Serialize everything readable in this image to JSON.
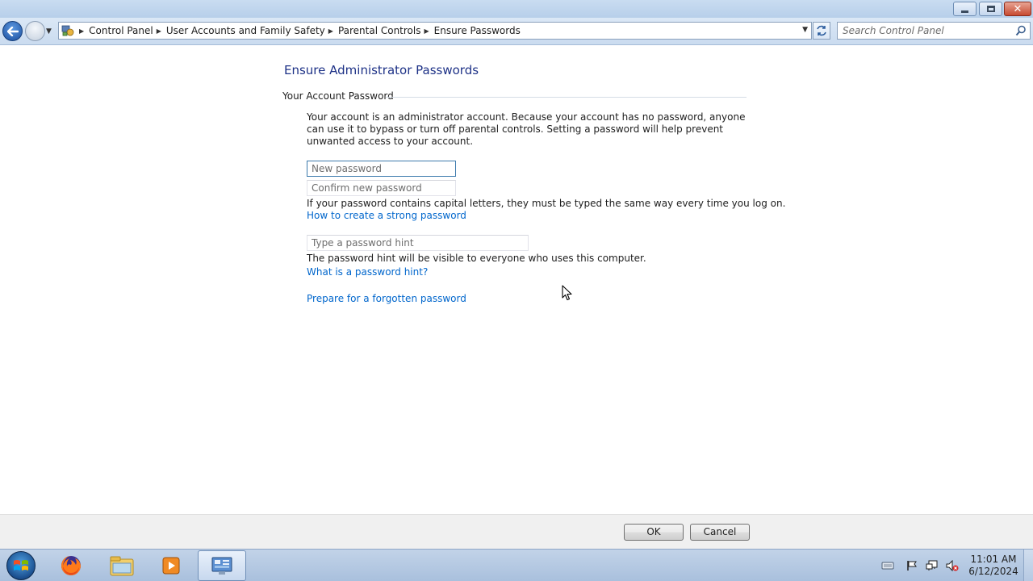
{
  "window": {
    "caption_buttons": [
      "minimize",
      "maximize",
      "close"
    ]
  },
  "navigation": {
    "breadcrumb": [
      "Control Panel",
      "User Accounts and Family Safety",
      "Parental Controls",
      "Ensure Passwords"
    ],
    "search_placeholder": "Search Control Panel"
  },
  "page": {
    "title": "Ensure Administrator Passwords",
    "section_heading": "Your Account Password",
    "description": "Your account is an administrator account. Because your account has no password, anyone can use it to bypass or turn off parental controls. Setting a password will help prevent unwanted access to your account.",
    "new_password_placeholder": "New password",
    "confirm_password_placeholder": "Confirm new password",
    "caps_note": "If your password contains capital letters, they must be typed the same way every time you log on.",
    "strong_password_link": "How to create a strong password",
    "hint_placeholder": "Type a password hint",
    "hint_note": "The password hint will be visible to everyone who uses this computer.",
    "hint_help_link": "What is a password hint?",
    "forgotten_link": "Prepare for a forgotten password"
  },
  "buttons": {
    "ok": "OK",
    "cancel": "Cancel"
  },
  "taskbar": {
    "pinned": [
      "firefox-icon",
      "windows-explorer-icon",
      "media-player-icon",
      "control-panel-icon"
    ],
    "active_app": "control-panel-icon",
    "tray_icons": [
      "keyboard-icon",
      "action-center-flag-icon",
      "network-icon",
      "volume-muted-icon"
    ],
    "time": "11:01 AM",
    "date": "6/12/2024"
  },
  "colors": {
    "title_blue": "#1e3287",
    "link_blue": "#0066cc",
    "close_red": "#c74a31"
  }
}
